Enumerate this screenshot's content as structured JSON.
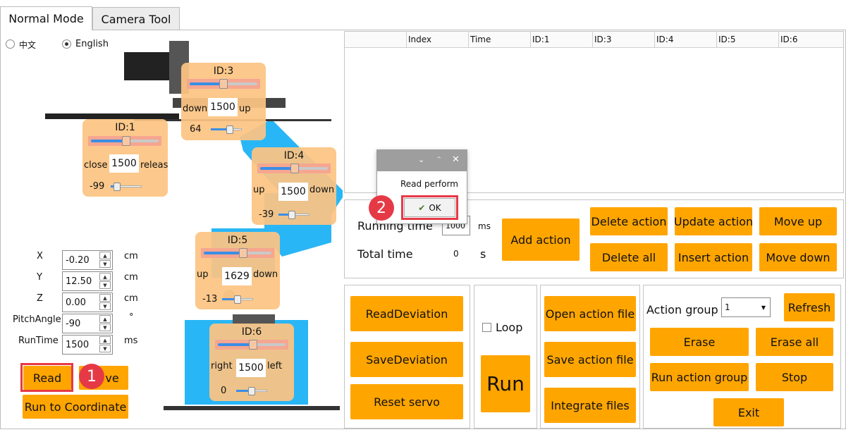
{
  "tabs": [
    {
      "label": "Normal Mode"
    },
    {
      "label": "Camera Tool"
    }
  ],
  "language": {
    "chinese": "中文",
    "english": "English",
    "selected": "English"
  },
  "servos": {
    "id3": {
      "title": "ID:3",
      "left": "down",
      "value": "1500",
      "right": "up",
      "dev": "64"
    },
    "id1": {
      "title": "ID:1",
      "left": "close",
      "value": "1500",
      "right": "releas",
      "dev": "-99"
    },
    "id4": {
      "title": "ID:4",
      "left": "up",
      "value": "1500",
      "right": "down",
      "dev": "-39"
    },
    "id5": {
      "title": "ID:5",
      "left": "up",
      "value": "1629",
      "right": "down",
      "dev": "-13"
    },
    "id6": {
      "title": "ID:6",
      "left": "right",
      "value": "1500",
      "right": "left",
      "dev": "0"
    }
  },
  "coords": [
    {
      "label": "X",
      "value": "-0.20",
      "unit": "cm"
    },
    {
      "label": "Y",
      "value": "12.50",
      "unit": "cm"
    },
    {
      "label": "Z",
      "value": "0.00",
      "unit": "cm"
    },
    {
      "label": "PitchAngle",
      "value": "-90",
      "unit": "°"
    },
    {
      "label": "RunTime",
      "value": "1500",
      "unit": "ms"
    }
  ],
  "left_buttons": {
    "read": "Read",
    "save": "ve",
    "run_coord": "Run to Coordinate"
  },
  "table": {
    "headers": [
      "",
      "Index",
      "Time",
      "ID:1",
      "ID:3",
      "ID:4",
      "ID:5",
      "ID:6"
    ]
  },
  "action": {
    "running_time_label": "Running time",
    "running_time_value": "1000",
    "running_time_unit": "ms",
    "total_time_label": "Total time",
    "total_time_value": "0",
    "total_time_unit": "s",
    "add": "Add action",
    "delete": "Delete action",
    "update": "Update action",
    "move_up": "Move up",
    "delete_all": "Delete all",
    "insert": "Insert action",
    "move_down": "Move down"
  },
  "deviation": {
    "read": "ReadDeviation",
    "save": "SaveDeviation",
    "reset": "Reset servo"
  },
  "run_panel": {
    "loop": "Loop",
    "run": "Run"
  },
  "files": {
    "open": "Open action file",
    "save": "Save action file",
    "integrate": "Integrate files"
  },
  "group": {
    "label": "Action group",
    "selected": "1",
    "refresh": "Refresh",
    "erase": "Erase",
    "erase_all": "Erase all",
    "run_group": "Run action group",
    "stop": "Stop",
    "exit": "Exit"
  },
  "dialog": {
    "message": "Read perform",
    "ok": "OK"
  },
  "markers": {
    "one": "1",
    "two": "2"
  },
  "colors": {
    "accent": "#ffa500",
    "highlight": "#e63946",
    "servo_panel": "#fcc482",
    "slider": "#3a8ee6"
  }
}
